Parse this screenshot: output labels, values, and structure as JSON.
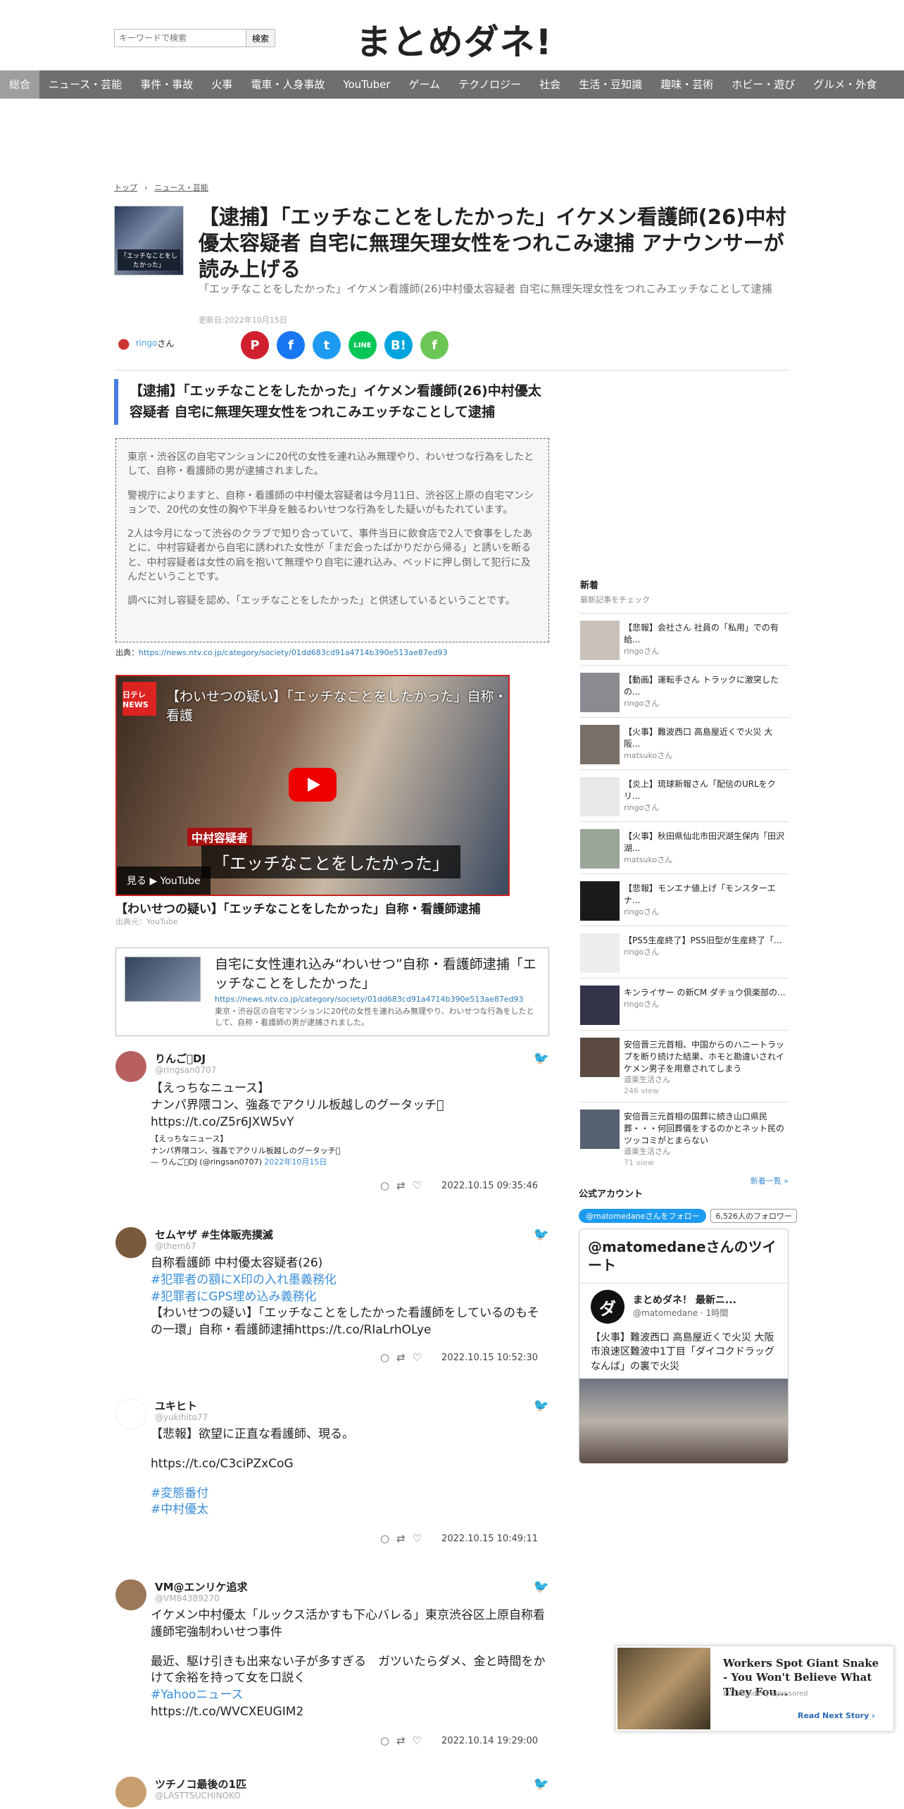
{
  "header": {
    "search_placeholder": "キーワードで検索",
    "search_button": "検索",
    "logo": "まとめダネ!"
  },
  "nav": [
    "総合",
    "ニュース・芸能",
    "事件・事故",
    "火事",
    "電車・人身事故",
    "YouTuber",
    "ゲーム",
    "テクノロジー",
    "社会",
    "生活・豆知識",
    "趣味・芸術",
    "ホビー・遊び",
    "グルメ・外食"
  ],
  "breadcrumb": [
    "トップ",
    "ニュース・芸能"
  ],
  "article": {
    "thumb_caption": "「エッチなことをしたかった」",
    "title": "【逮捕】「エッチなことをしたかった」イケメン看護師(26)中村優太容疑者 自宅に無理矢理女性をつれこみ逮捕 アナウンサーが読み上げる",
    "subtitle": "「エッチなことをしたかった」イケメン看護師(26)中村優太容疑者 自宅に無理矢理女性をつれこみエッチなことして逮捕",
    "date": "更新日:2022年10月15日",
    "author": "ringo",
    "author_suffix": "さん",
    "heading": "【逮捕】「エッチなことをしたかった」イケメン看護師(26)中村優太容疑者 自宅に無理矢理女性をつれこみエッチなことして逮捕",
    "quote": [
      "東京・渋谷区の自宅マンションに20代の女性を連れ込み無理やり、わいせつな行為をしたとして、自称・看護師の男が逮捕されました。",
      "警視庁によりますと、自称・看護師の中村優太容疑者は今月11日、渋谷区上原の自宅マンションで、20代の女性の胸や下半身を触るわいせつな行為をした疑いがもたれています。",
      "2人は今月になって渋谷のクラブで知り合っていて、事件当日に飲食店で2人で食事をしたあとに、中村容疑者から自宅に誘われた女性が「まだ会ったばかりだから帰る」と誘いを断ると、中村容疑者は女性の肩を抱いて無理やり自宅に連れ込み、ベッドに押し倒して犯行に及んだということです。",
      "調べに対し容疑を認め、「エッチなことをしたかった」と供述しているということです。"
    ],
    "source_label": "出典：",
    "source_url": "https://news.ntv.co.jp/category/society/01dd683cd91a4714b390e513ae87ed93"
  },
  "video": {
    "logo": "日テレNEWS",
    "top_text": "【わいせつの疑い】「エッチなことをしたかった」自称・看護",
    "tag": "中村容疑者",
    "subtitle": "「エッチなことをしたかった」",
    "watch": "見る ▶ YouTube",
    "caption": "【わいせつの疑い】「エッチなことをしたかった」自称・看護師逮捕",
    "source": "出典元：YouTube"
  },
  "card": {
    "title": "自宅に女性連れ込み“わいせつ”自称・看護師逮捕「エッチなことをしたかった」",
    "url": "https://news.ntv.co.jp/category/society/01dd683cd91a4714b390e513ae87ed93",
    "desc": "東京・渋谷区の自宅マンションに20代の女性を連れ込み無理やり、わいせつな行為をしたとして、自称・看護師の男が逮捕されました。"
  },
  "tweets": [
    {
      "name": "りんご􏿿DJ",
      "handle": "@ringsan0707",
      "body": "【えっちなニュース】\nナンパ界隈コン、強姦でアクリル板越しのグータッチ􏿿 https://t.co/Z5r6JXW5vY",
      "small": "【えっちなニュース】\nナンパ界隈コン、強姦でアクリル板越しのグータッチ􏿿\n— りんご􏿿DJ (@ringsan0707) ",
      "small_date": "2022年10月15日",
      "time": "2022.10.15 09:35:46"
    },
    {
      "name": "セムヤザ #生体販売撲滅",
      "handle": "@them67",
      "l1": "自称看護師 中村優太容疑者(26)",
      "h1": "#犯罪者の額にX印の入れ墨義務化",
      "h2": "#犯罪者にGPS埋め込み義務化",
      "l2": "【わいせつの疑い】「エッチなことをしたかった看護師をしているのもその一環」自称・看護師逮捕https://t.co/RIaLrhOLye",
      "time": "2022.10.15 10:52:30"
    },
    {
      "name": "ユキヒト",
      "handle": "@yukihito77",
      "l1": "【悲報】欲望に正直な看護師、現る。",
      "l2": "https://t.co/C3ciPZxCoG",
      "h1": "#変態番付",
      "h2": "#中村優太",
      "time": "2022.10.15 10:49:11"
    },
    {
      "name": "VM@エンリケ追求",
      "handle": "@VM84389270",
      "l1": "イケメン中村優太「ルックス活かすも下心バレる」東京渋谷区上原自称看護師宅強制わいせつ事件",
      "l2": "最近、駆け引きも出来ない子が多すぎる　ガツいたらダメ、金と時間をかけて余裕を持って女を口説く",
      "h1": "#Yahooニュース",
      "l3": "https://t.co/WVCXEUGIM2",
      "time": "2022.10.14 19:29:00"
    },
    {
      "name": "ツチノコ最後の1匹",
      "handle": "@LASTTSUCHINOKO"
    }
  ],
  "sidebar": {
    "title": "新着",
    "subtitle": "最新記事をチェック",
    "items": [
      {
        "title": "【悲報】会社さん 社員の「私用」での有給...",
        "author": "ringo",
        "views": ""
      },
      {
        "title": "【動画】運転手さん トラックに激突した の...",
        "author": "ringo",
        "views": ""
      },
      {
        "title": "【火事】難波西口 高島屋近くで火災 大阪...",
        "author": "matsuko",
        "views": ""
      },
      {
        "title": "【炎上】琉球新報さん「配信のURLをクリ...",
        "author": "ringo",
        "views": ""
      },
      {
        "title": "【火事】秋田県仙北市田沢湖生保内「田沢湖...",
        "author": "matsuko",
        "views": ""
      },
      {
        "title": "【悲報】モンエナ値上げ「モンスターエナ...",
        "author": "ringo",
        "views": ""
      },
      {
        "title": "【PS5生産終了】PS5旧型が生産終了「...",
        "author": "ringo",
        "views": ""
      },
      {
        "title": "キンライサー の新CM ダチョウ倶楽部の...",
        "author": "ringo",
        "views": ""
      },
      {
        "title": "安倍晋三元首相、中国からのハニートラップを断り続けた結果、ホモと勘違いされイケメン男子を用意されてしまう",
        "author": "道楽生活",
        "views": "246 view"
      },
      {
        "title": "安倍晋三元首相の国葬に続き山口県民葬・・・何回葬儀をするのかとネット民のツッコミがとまらない",
        "author": "道楽生活",
        "views": "71 view"
      }
    ],
    "more": "新着一覧 »",
    "suffix": "さん"
  },
  "official": {
    "title": "公式アカウント",
    "follow": "@matomedaneさんをフォロー",
    "count": "6,526人のフォロワー"
  },
  "twbox": {
    "header": "@matomedaneさんのツイート",
    "logo": "ダ",
    "name": "まとめダネ！ 最新ニ...",
    "handle": "@matomedane · 1時間",
    "body": "【火事】難波西口 高島屋近くで火災 大阪市浪速区難波中1丁目「ダイコクドラッグ なんば」の裏で火災"
  },
  "ad": {
    "title": "Workers Spot Giant Snake - You Won't Believe What They Fou...",
    "sponsor": "PDFWonder | Sponsored",
    "cta": "Read Next Story ›"
  },
  "colors": {
    "nav": "#6f6f6f",
    "accent": "#4a7de0",
    "link": "#2b7ab8"
  },
  "share_icons": [
    "pinterest-icon",
    "facebook-icon",
    "twitter-icon",
    "line-icon",
    "hatena-icon",
    "feedly-icon"
  ]
}
